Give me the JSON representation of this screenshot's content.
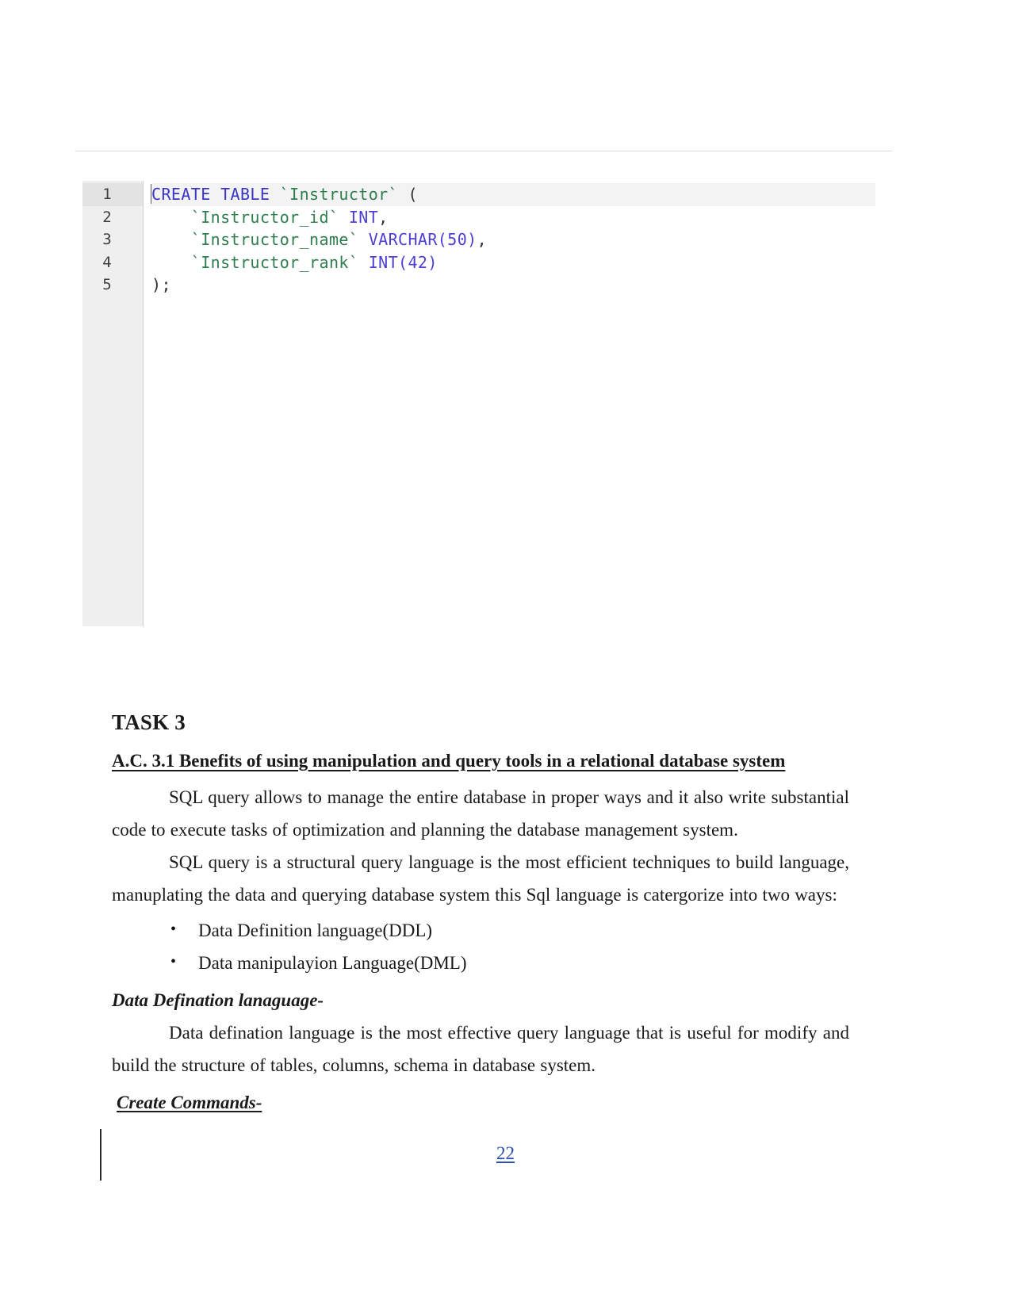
{
  "document": {
    "page_number": "22",
    "page_number_color": "#2b4dad"
  },
  "code_block": {
    "editor_kind": "sql-editor",
    "line_numbers": [
      "1",
      "2",
      "3",
      "4",
      "5"
    ],
    "active_line": "1",
    "lines": [
      {
        "number": "1",
        "tokens": [
          {
            "text": "CREATE TABLE ",
            "kind": "keyword"
          },
          {
            "text": "`Instructor`",
            "kind": "identifier"
          },
          {
            "text": " (",
            "kind": "plain"
          }
        ]
      },
      {
        "number": "2",
        "tokens": [
          {
            "text": "    `Instructor_id`",
            "kind": "identifier"
          },
          {
            "text": " ",
            "kind": "plain"
          },
          {
            "text": "INT",
            "kind": "type"
          },
          {
            "text": ",",
            "kind": "plain"
          }
        ]
      },
      {
        "number": "3",
        "tokens": [
          {
            "text": "    `Instructor_name`",
            "kind": "identifier"
          },
          {
            "text": " ",
            "kind": "plain"
          },
          {
            "text": "VARCHAR(50)",
            "kind": "type"
          },
          {
            "text": ",",
            "kind": "plain"
          }
        ]
      },
      {
        "number": "4",
        "tokens": [
          {
            "text": "    `Instructor_rank`",
            "kind": "identifier"
          },
          {
            "text": " ",
            "kind": "plain"
          },
          {
            "text": "INT(42)",
            "kind": "type"
          }
        ]
      },
      {
        "number": "5",
        "tokens": [
          {
            "text": ");",
            "kind": "plain"
          }
        ]
      }
    ],
    "plain_text": "CREATE TABLE `Instructor` (\n    `Instructor_id` INT,\n    `Instructor_name` VARCHAR(50),\n    `Instructor_rank` INT(42)\n);",
    "colors": {
      "keyword": "#3a33c8",
      "identifier": "#2e7d4f",
      "type": "#4b3fd4",
      "plain": "#303030",
      "gutter_background": "#efefef",
      "active_line_background": "#f3f3f3"
    }
  },
  "content": {
    "task_heading": "TASK 3",
    "ac_heading": "A.C. 3.1  Benefits of using manipulation and query tools in a relational database system ",
    "paragraph_1": "SQL query allows to manage the entire database in proper ways and it  also write substantial  code to execute  tasks of optimization and planning the database management system.",
    "paragraph_2": "SQL query is a structural query language is the most efficient techniques to build language, manuplating the data and querying database system this Sql language is catergorize into two ways:",
    "bullets": [
      "Data Definition language(DDL)",
      "Data manipulayion Language(DML)"
    ],
    "subheading_1": "Data Defination lanaguage-",
    "paragraph_3": "Data defination language is the most effective query language that is useful for modify and build the structure of tables, columns, schema in database system.",
    "subheading_2": "Create Commands-"
  }
}
